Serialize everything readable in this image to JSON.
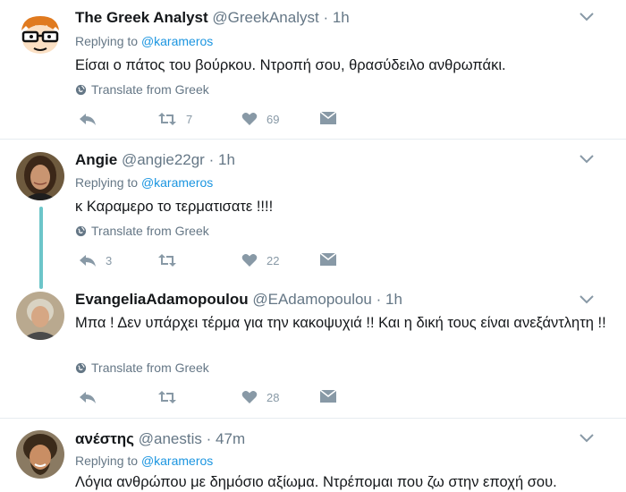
{
  "tweets": [
    {
      "name": "The Greek Analyst",
      "handle": "@GreekAnalyst",
      "dot": "·",
      "time": "1h",
      "replying_prefix": "Replying to ",
      "replying_to": "@karameros",
      "text": "Είσαι ο πάτος του βούρκου. Ντροπή σου, θρασύδειλο ανθρωπάκι.",
      "translate": "Translate from Greek",
      "reply_count": "",
      "retweet_count": "7",
      "like_count": "69"
    },
    {
      "name": "Angie",
      "handle": "@angie22gr",
      "dot": "·",
      "time": "1h",
      "replying_prefix": "Replying to ",
      "replying_to": "@karameros",
      "text": "κ Καραμερο το τερματισατε !!!!",
      "translate": "Translate from Greek",
      "reply_count": "3",
      "retweet_count": "",
      "like_count": "22"
    },
    {
      "name": "EvangeliaAdamopoulou",
      "handle": "@EAdamopoulou",
      "dot": "·",
      "time": "1h",
      "text": "Μπα ! Δεν υπάρχει τέρμα για την κακοψυχιά !! Και η δική τους είναι ανεξάντλητη !!",
      "translate": "Translate from Greek",
      "reply_count": "",
      "retweet_count": "",
      "like_count": "28"
    },
    {
      "name": "ανέστης",
      "handle": "@anestis",
      "dot": "·",
      "time": "47m",
      "replying_prefix": "Replying to ",
      "replying_to": "@karameros",
      "text": "Λόγια ανθρώπου με δημόσιο αξίωμα. Ντρέπομαι που ζω στην εποχή σου."
    }
  ],
  "colors": {
    "link": "#1b95e0",
    "muted": "#657786",
    "icon": "#8899a6",
    "thread_line": "#6cc5c9",
    "divider": "#e6ecf0"
  }
}
